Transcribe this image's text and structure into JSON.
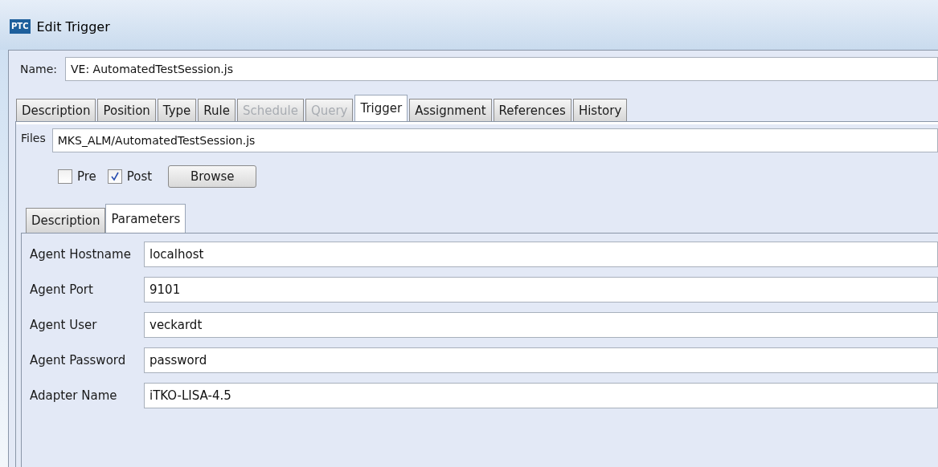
{
  "window": {
    "title": "Edit Trigger",
    "logo": "PTC"
  },
  "name": {
    "label": "Name:",
    "value": "VE: AutomatedTestSession.js"
  },
  "tabs": [
    {
      "label": "Description",
      "selected": false,
      "disabled": false
    },
    {
      "label": "Position",
      "selected": false,
      "disabled": false
    },
    {
      "label": "Type",
      "selected": false,
      "disabled": false
    },
    {
      "label": "Rule",
      "selected": false,
      "disabled": false
    },
    {
      "label": "Schedule",
      "selected": false,
      "disabled": true
    },
    {
      "label": "Query",
      "selected": false,
      "disabled": true
    },
    {
      "label": "Trigger",
      "selected": true,
      "disabled": false
    },
    {
      "label": "Assignment",
      "selected": false,
      "disabled": false
    },
    {
      "label": "References",
      "selected": false,
      "disabled": false
    },
    {
      "label": "History",
      "selected": false,
      "disabled": false
    }
  ],
  "files": {
    "label": "Files",
    "value": "MKS_ALM/AutomatedTestSession.js"
  },
  "options": [
    {
      "label": "Pre",
      "checked": false
    },
    {
      "label": "Post",
      "checked": true
    }
  ],
  "browse_button": "Browse",
  "sub_tabs": [
    {
      "label": "Description",
      "selected": false
    },
    {
      "label": "Parameters",
      "selected": true
    }
  ],
  "parameters": [
    {
      "label": "Agent Hostname",
      "value": "localhost"
    },
    {
      "label": "Agent Port",
      "value": "9101"
    },
    {
      "label": "Agent User",
      "value": "veckardt"
    },
    {
      "label": "Agent Password",
      "value": "password"
    },
    {
      "label": "Adapter Name",
      "value": "iTKO-LISA-4.5"
    }
  ]
}
